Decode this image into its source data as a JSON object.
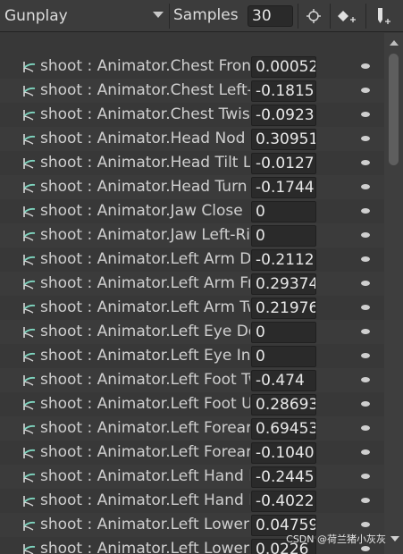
{
  "toolbar": {
    "clip_name": "Gunplay",
    "samples_label": "Samples",
    "samples_value": "30",
    "icons": [
      "keyframe-target-icon",
      "add-keyframe-icon",
      "add-event-icon"
    ]
  },
  "colors": {
    "background": "#383838",
    "row_alt": "#3b3b3b",
    "field_bg": "#2a2a2a",
    "curve_icon": "#7fd6c0"
  },
  "properties": [
    {
      "name": "shoot : Animator.Chest Front-Back",
      "value": "0.00052"
    },
    {
      "name": "shoot : Animator.Chest Left-Right",
      "value": "-0.1815"
    },
    {
      "name": "shoot : Animator.Chest Twist Left-Right",
      "value": "-0.0923"
    },
    {
      "name": "shoot : Animator.Head Nod Down-Up",
      "value": "0.30951"
    },
    {
      "name": "shoot : Animator.Head Tilt Left-Right",
      "value": "-0.0127"
    },
    {
      "name": "shoot : Animator.Head Turn Left-Right",
      "value": "-0.1744"
    },
    {
      "name": "shoot : Animator.Jaw Close",
      "value": "0"
    },
    {
      "name": "shoot : Animator.Jaw Left-Right",
      "value": "0"
    },
    {
      "name": "shoot : Animator.Left Arm Down-Up",
      "value": "-0.2112"
    },
    {
      "name": "shoot : Animator.Left Arm Front-Back",
      "value": "0.29374"
    },
    {
      "name": "shoot : Animator.Left Arm Twist In-Out",
      "value": "0.21976"
    },
    {
      "name": "shoot : Animator.Left Eye Down-Up",
      "value": "0"
    },
    {
      "name": "shoot : Animator.Left Eye In-Out",
      "value": "0"
    },
    {
      "name": "shoot : Animator.Left Foot Twist In-Out",
      "value": "-0.474"
    },
    {
      "name": "shoot : Animator.Left Foot Up-Down",
      "value": "0.28693"
    },
    {
      "name": "shoot : Animator.Left Forearm Stretch",
      "value": "0.69453"
    },
    {
      "name": "shoot : Animator.Left Forearm Twist In-Out",
      "value": "-0.1040"
    },
    {
      "name": "shoot : Animator.Left Hand Down-Up",
      "value": "-0.2445"
    },
    {
      "name": "shoot : Animator.Left Hand In-Out",
      "value": "-0.4022"
    },
    {
      "name": "shoot : Animator.Left Lower Leg Stretch",
      "value": "0.04759"
    },
    {
      "name": "shoot : Animator.Left Lower Leg Twist In-Out",
      "value": "0.0226"
    }
  ],
  "watermark": "CSDN @荷兰猪小灰灰"
}
